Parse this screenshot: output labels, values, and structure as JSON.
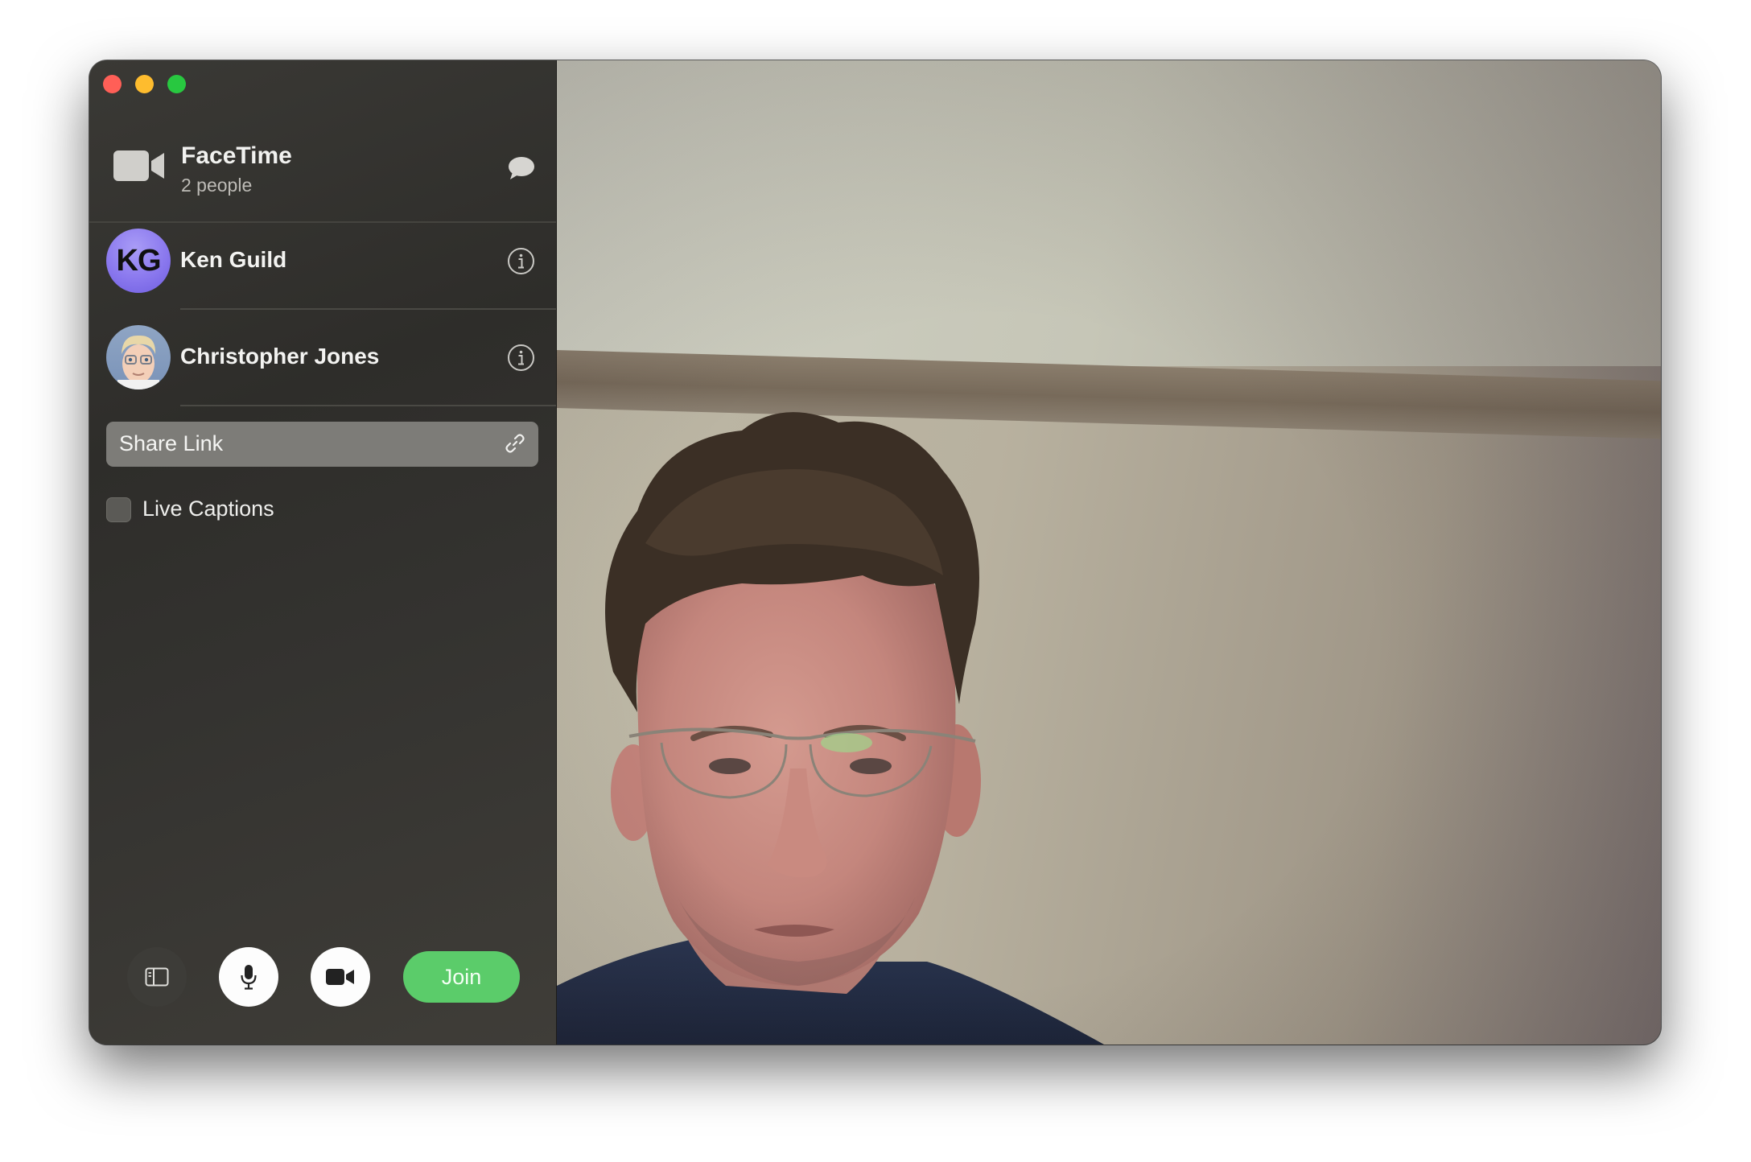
{
  "window": {
    "traffic_lights": [
      "close",
      "minimize",
      "zoom"
    ]
  },
  "header": {
    "title": "FaceTime",
    "subtitle": "2 people",
    "app_icon": "video-camera-icon",
    "chat_icon": "chat-bubble-icon"
  },
  "participants": [
    {
      "initials": "KG",
      "name": "Ken Guild",
      "avatar_color": "#8a78ee"
    },
    {
      "initials": "",
      "name": "Christopher Jones",
      "avatar": "memoji"
    }
  ],
  "share_link": {
    "label": "Share Link",
    "icon": "link-icon"
  },
  "live_captions": {
    "label": "Live Captions",
    "checked": false
  },
  "controls": {
    "sidebar_icon": "sidebar-icon",
    "mic_icon": "microphone-icon",
    "video_icon": "video-camera-icon",
    "join_label": "Join",
    "join_color": "#5bcc6a"
  }
}
